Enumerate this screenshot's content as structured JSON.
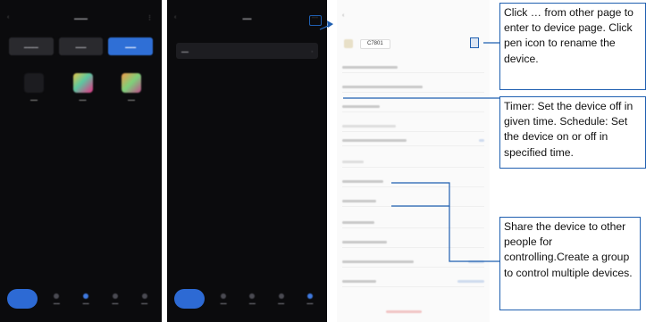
{
  "colors": {
    "accent": "#1f5fb0",
    "phone_bg": "#0b0b0d",
    "active_tab": "#2f6fd6"
  },
  "device_page": {
    "device_name": "C7801"
  },
  "callouts": [
    {
      "text": "Click … from other page to enter to device page. Click pen icon to rename the device."
    },
    {
      "text": "Timer: Set the device off in given time. Schedule: Set the device on or off in specified time."
    },
    {
      "text": "Share the device to other people for controlling.Create a group to control multiple devices."
    }
  ],
  "icons": {
    "back": "chevron-left-icon",
    "more": "more-icon",
    "pen": "pen-icon"
  }
}
